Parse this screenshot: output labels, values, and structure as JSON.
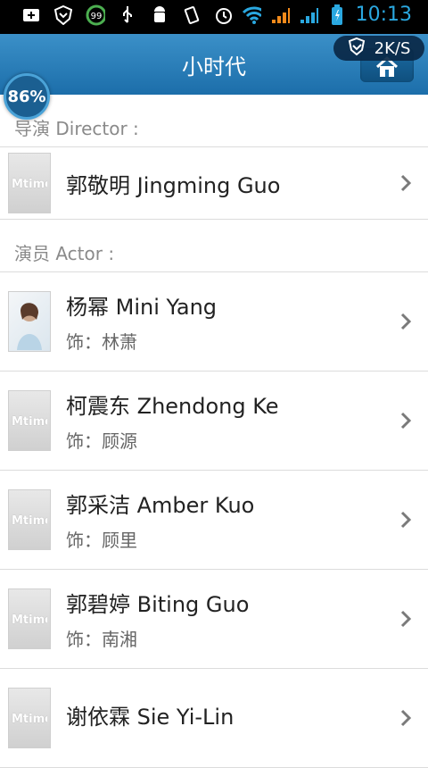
{
  "status_bar": {
    "time": "10:13",
    "battery_ring": "99",
    "icons": [
      "plus-icon",
      "shield-icon",
      "usb-icon",
      "android-icon",
      "vibrate-icon",
      "alarm-icon",
      "wifi-icon",
      "signal-icon",
      "battery-icon"
    ],
    "colors": {
      "time": "#2aa8e0",
      "wifi": "#2aa8e0",
      "signal": "#f28a1b"
    }
  },
  "title_bar": {
    "title": "小时代",
    "speed": "2K/S",
    "badge_percent": "86%"
  },
  "sections": [
    {
      "header": "导演 Director :",
      "items": [
        {
          "name": "郭敬明 Jingming Guo",
          "role": ""
        }
      ]
    },
    {
      "header": "演员 Actor :",
      "items": [
        {
          "name": "杨幂 Mini Yang",
          "role": "饰：林萧"
        },
        {
          "name": "柯震东 Zhendong Ke",
          "role": "饰：顾源"
        },
        {
          "name": "郭采洁 Amber Kuo",
          "role": "饰：顾里"
        },
        {
          "name": "郭碧婷 Biting Guo",
          "role": "饰：南湘"
        },
        {
          "name": "谢依霖 Sie Yi-Lin",
          "role": ""
        }
      ]
    }
  ]
}
